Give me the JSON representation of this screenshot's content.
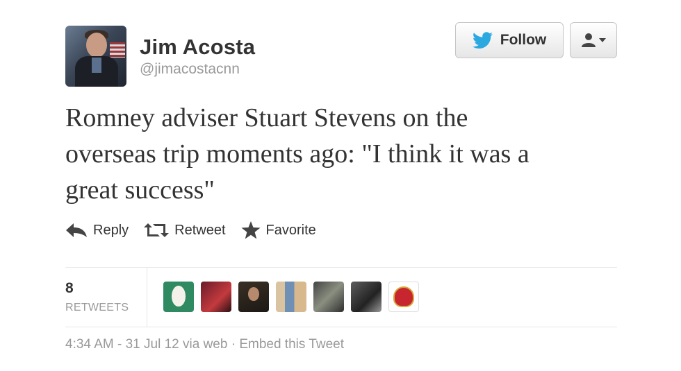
{
  "user": {
    "display_name": "Jim Acosta",
    "screen_name": "@jimacostacnn"
  },
  "buttons": {
    "follow_label": "Follow"
  },
  "tweet": {
    "text": "Romney adviser Stuart Stevens on the\noverseas trip moments ago: \"I think it was a\ngreat success\""
  },
  "actions": {
    "reply": "Reply",
    "retweet": "Retweet",
    "favorite": "Favorite"
  },
  "stats": {
    "retweet_count": "8",
    "retweet_label": "RETWEETS"
  },
  "footer": {
    "timestamp": "4:34 AM - 31 Jul 12",
    "via": "via web",
    "separator": "·",
    "embed": "Embed this Tweet"
  },
  "colors": {
    "twitter_blue": "#2aa9e0",
    "text": "#333333",
    "muted": "#999999"
  }
}
